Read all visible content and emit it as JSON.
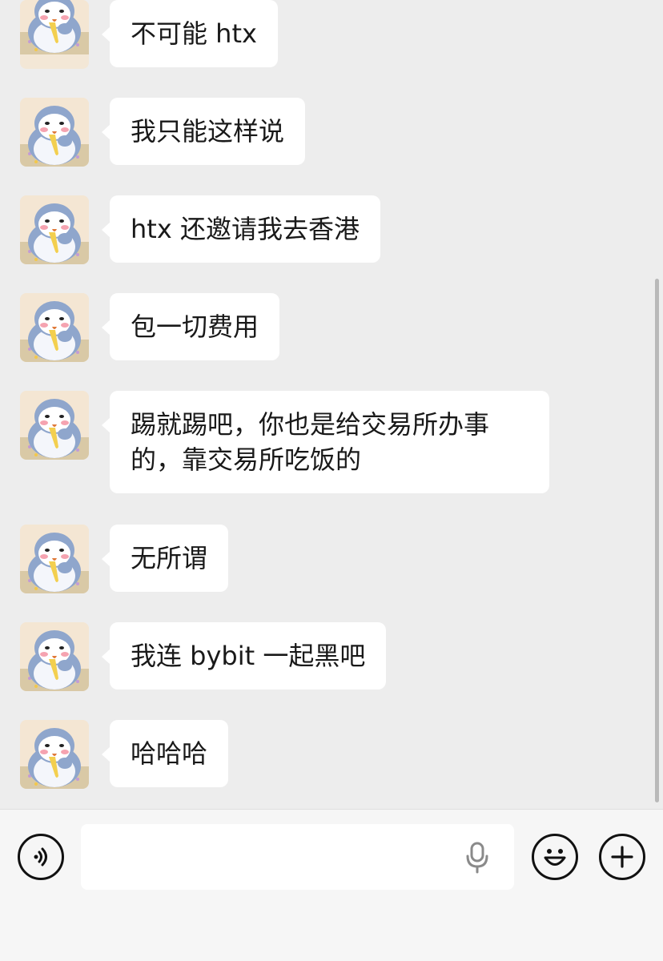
{
  "messages": [
    {
      "text": "不可能 htx"
    },
    {
      "text": "我只能这样说"
    },
    {
      "text": "htx 还邀请我去香港"
    },
    {
      "text": "包一切费用"
    },
    {
      "text": "踢就踢吧，你也是给交易所办事的，靠交易所吃饭的"
    },
    {
      "text": "无所谓"
    },
    {
      "text": "我连 bybit 一起黑吧"
    },
    {
      "text": "哈哈哈"
    }
  ],
  "input": {
    "placeholder": "",
    "value": ""
  },
  "icons": {
    "voice": "voice-icon",
    "mic": "microphone-icon",
    "emoji": "emoji-icon",
    "more": "plus-icon",
    "avatar": "penguin-avatar"
  },
  "colors": {
    "background": "#ededed",
    "bubble": "#ffffff",
    "text": "#191919"
  }
}
